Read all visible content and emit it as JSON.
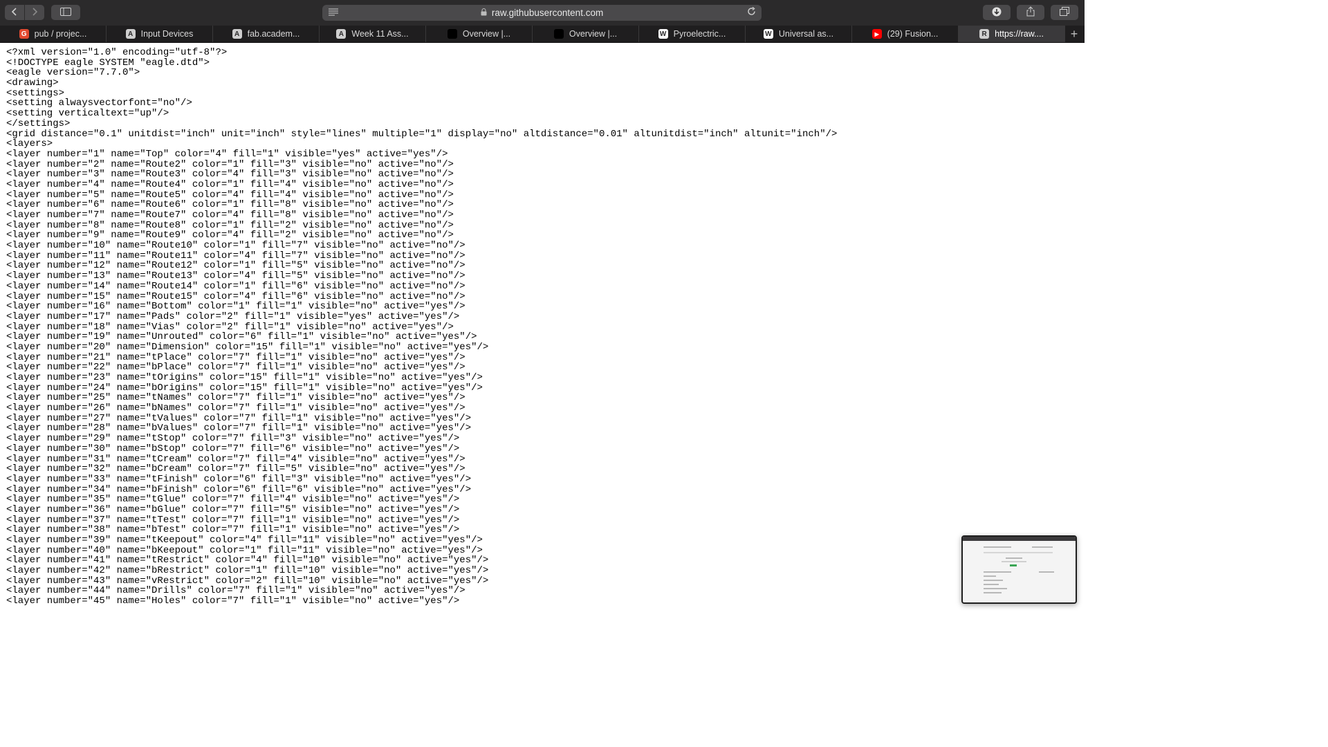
{
  "browser": {
    "url": "raw.githubusercontent.com",
    "icons": {
      "back": "chevron-left-icon",
      "forward": "chevron-right-icon",
      "sidebar": "sidebar-icon",
      "reader": "reader-icon",
      "lock": "lock-icon",
      "reload": "reload-icon",
      "download": "download-icon",
      "share": "share-icon",
      "tabs": "tab-overview-icon"
    }
  },
  "tabs": [
    {
      "label": "pub / projec...",
      "favicon": "G",
      "favicon_color": "#e2492f"
    },
    {
      "label": "Input Devices",
      "favicon": "A",
      "favicon_color": "#cfcfcf"
    },
    {
      "label": "fab.academ...",
      "favicon": "A",
      "favicon_color": "#cfcfcf"
    },
    {
      "label": "Week 11 Ass...",
      "favicon": "A",
      "favicon_color": "#cfcfcf"
    },
    {
      "label": "Overview |...",
      "favicon": "",
      "favicon_color": "#000000"
    },
    {
      "label": "Overview |...",
      "favicon": "",
      "favicon_color": "#000000"
    },
    {
      "label": "Pyroelectric...",
      "favicon": "W",
      "favicon_color": "#ffffff"
    },
    {
      "label": "Universal as...",
      "favicon": "W",
      "favicon_color": "#ffffff"
    },
    {
      "label": "(29) Fusion...",
      "favicon": "▶",
      "favicon_color": "#ff0000"
    },
    {
      "label": "https://raw....",
      "favicon": "R",
      "favicon_color": "#cfcfcf"
    }
  ],
  "active_tab": 9,
  "code_lines": [
    "<?xml version=\"1.0\" encoding=\"utf-8\"?>",
    "<!DOCTYPE eagle SYSTEM \"eagle.dtd\">",
    "<eagle version=\"7.7.0\">",
    "<drawing>",
    "<settings>",
    "<setting alwaysvectorfont=\"no\"/>",
    "<setting verticaltext=\"up\"/>",
    "</settings>",
    "<grid distance=\"0.1\" unitdist=\"inch\" unit=\"inch\" style=\"lines\" multiple=\"1\" display=\"no\" altdistance=\"0.01\" altunitdist=\"inch\" altunit=\"inch\"/>",
    "<layers>",
    "<layer number=\"1\" name=\"Top\" color=\"4\" fill=\"1\" visible=\"yes\" active=\"yes\"/>",
    "<layer number=\"2\" name=\"Route2\" color=\"1\" fill=\"3\" visible=\"no\" active=\"no\"/>",
    "<layer number=\"3\" name=\"Route3\" color=\"4\" fill=\"3\" visible=\"no\" active=\"no\"/>",
    "<layer number=\"4\" name=\"Route4\" color=\"1\" fill=\"4\" visible=\"no\" active=\"no\"/>",
    "<layer number=\"5\" name=\"Route5\" color=\"4\" fill=\"4\" visible=\"no\" active=\"no\"/>",
    "<layer number=\"6\" name=\"Route6\" color=\"1\" fill=\"8\" visible=\"no\" active=\"no\"/>",
    "<layer number=\"7\" name=\"Route7\" color=\"4\" fill=\"8\" visible=\"no\" active=\"no\"/>",
    "<layer number=\"8\" name=\"Route8\" color=\"1\" fill=\"2\" visible=\"no\" active=\"no\"/>",
    "<layer number=\"9\" name=\"Route9\" color=\"4\" fill=\"2\" visible=\"no\" active=\"no\"/>",
    "<layer number=\"10\" name=\"Route10\" color=\"1\" fill=\"7\" visible=\"no\" active=\"no\"/>",
    "<layer number=\"11\" name=\"Route11\" color=\"4\" fill=\"7\" visible=\"no\" active=\"no\"/>",
    "<layer number=\"12\" name=\"Route12\" color=\"1\" fill=\"5\" visible=\"no\" active=\"no\"/>",
    "<layer number=\"13\" name=\"Route13\" color=\"4\" fill=\"5\" visible=\"no\" active=\"no\"/>",
    "<layer number=\"14\" name=\"Route14\" color=\"1\" fill=\"6\" visible=\"no\" active=\"no\"/>",
    "<layer number=\"15\" name=\"Route15\" color=\"4\" fill=\"6\" visible=\"no\" active=\"no\"/>",
    "<layer number=\"16\" name=\"Bottom\" color=\"1\" fill=\"1\" visible=\"no\" active=\"yes\"/>",
    "<layer number=\"17\" name=\"Pads\" color=\"2\" fill=\"1\" visible=\"yes\" active=\"yes\"/>",
    "<layer number=\"18\" name=\"Vias\" color=\"2\" fill=\"1\" visible=\"no\" active=\"yes\"/>",
    "<layer number=\"19\" name=\"Unrouted\" color=\"6\" fill=\"1\" visible=\"no\" active=\"yes\"/>",
    "<layer number=\"20\" name=\"Dimension\" color=\"15\" fill=\"1\" visible=\"no\" active=\"yes\"/>",
    "<layer number=\"21\" name=\"tPlace\" color=\"7\" fill=\"1\" visible=\"no\" active=\"yes\"/>",
    "<layer number=\"22\" name=\"bPlace\" color=\"7\" fill=\"1\" visible=\"no\" active=\"yes\"/>",
    "<layer number=\"23\" name=\"tOrigins\" color=\"15\" fill=\"1\" visible=\"no\" active=\"yes\"/>",
    "<layer number=\"24\" name=\"bOrigins\" color=\"15\" fill=\"1\" visible=\"no\" active=\"yes\"/>",
    "<layer number=\"25\" name=\"tNames\" color=\"7\" fill=\"1\" visible=\"no\" active=\"yes\"/>",
    "<layer number=\"26\" name=\"bNames\" color=\"7\" fill=\"1\" visible=\"no\" active=\"yes\"/>",
    "<layer number=\"27\" name=\"tValues\" color=\"7\" fill=\"1\" visible=\"no\" active=\"yes\"/>",
    "<layer number=\"28\" name=\"bValues\" color=\"7\" fill=\"1\" visible=\"no\" active=\"yes\"/>",
    "<layer number=\"29\" name=\"tStop\" color=\"7\" fill=\"3\" visible=\"no\" active=\"yes\"/>",
    "<layer number=\"30\" name=\"bStop\" color=\"7\" fill=\"6\" visible=\"no\" active=\"yes\"/>",
    "<layer number=\"31\" name=\"tCream\" color=\"7\" fill=\"4\" visible=\"no\" active=\"yes\"/>",
    "<layer number=\"32\" name=\"bCream\" color=\"7\" fill=\"5\" visible=\"no\" active=\"yes\"/>",
    "<layer number=\"33\" name=\"tFinish\" color=\"6\" fill=\"3\" visible=\"no\" active=\"yes\"/>",
    "<layer number=\"34\" name=\"bFinish\" color=\"6\" fill=\"6\" visible=\"no\" active=\"yes\"/>",
    "<layer number=\"35\" name=\"tGlue\" color=\"7\" fill=\"4\" visible=\"no\" active=\"yes\"/>",
    "<layer number=\"36\" name=\"bGlue\" color=\"7\" fill=\"5\" visible=\"no\" active=\"yes\"/>",
    "<layer number=\"37\" name=\"tTest\" color=\"7\" fill=\"1\" visible=\"no\" active=\"yes\"/>",
    "<layer number=\"38\" name=\"bTest\" color=\"7\" fill=\"1\" visible=\"no\" active=\"yes\"/>",
    "<layer number=\"39\" name=\"tKeepout\" color=\"4\" fill=\"11\" visible=\"no\" active=\"yes\"/>",
    "<layer number=\"40\" name=\"bKeepout\" color=\"1\" fill=\"11\" visible=\"no\" active=\"yes\"/>",
    "<layer number=\"41\" name=\"tRestrict\" color=\"4\" fill=\"10\" visible=\"no\" active=\"yes\"/>",
    "<layer number=\"42\" name=\"bRestrict\" color=\"1\" fill=\"10\" visible=\"no\" active=\"yes\"/>",
    "<layer number=\"43\" name=\"vRestrict\" color=\"2\" fill=\"10\" visible=\"no\" active=\"yes\"/>",
    "<layer number=\"44\" name=\"Drills\" color=\"7\" fill=\"1\" visible=\"no\" active=\"yes\"/>",
    "<layer number=\"45\" name=\"Holes\" color=\"7\" fill=\"1\" visible=\"no\" active=\"yes\"/>"
  ]
}
